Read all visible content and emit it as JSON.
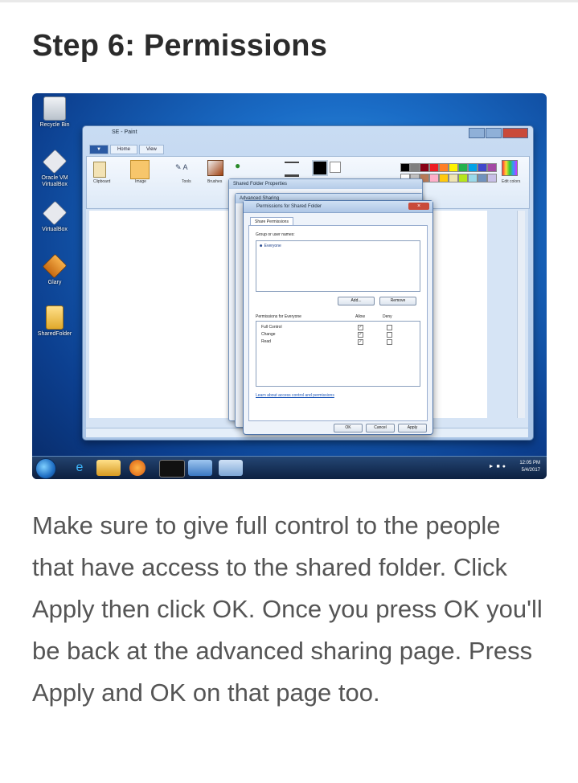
{
  "article": {
    "title": "Step 6: Permissions",
    "caption": "Make sure to give full control to the people that have access to the shared folder. Click Apply then click OK. Once you press OK you'll be back at the advanced sharing page. Press Apply and OK on that page too."
  },
  "screenshot": {
    "desktop_icons": [
      {
        "label": "Recycle Bin",
        "icon": "recycle-bin-icon",
        "color": "#d8dde3"
      },
      {
        "label": "Oracle VM VirtualBox",
        "icon": "virtualbox-icon",
        "color": "#e7e9ee"
      },
      {
        "label": "VirtualBox",
        "icon": "box-icon",
        "color": "#e7e9ee"
      },
      {
        "label": "Glary",
        "icon": "package-icon",
        "color": "#e58b25"
      },
      {
        "label": "SharedFolder",
        "icon": "folder-icon",
        "color": "#f2c94c"
      }
    ],
    "paint": {
      "title": "SE - Paint",
      "tabs": [
        "Home",
        "View"
      ],
      "file_tab": "",
      "groups": [
        "Clipboard",
        "Image",
        "Tools",
        "Brushes",
        "Shapes",
        "Size",
        "Color 1",
        "Color 2",
        "Edit colors"
      ],
      "swatch_colors": [
        "#000000",
        "#7f7f7f",
        "#880015",
        "#ed1c24",
        "#ff7f27",
        "#fff200",
        "#22b14c",
        "#00a2e8",
        "#3f48cc",
        "#a349a4",
        "#ffffff",
        "#c3c3c3",
        "#b97a57",
        "#ffaec9",
        "#ffc90e",
        "#efe4b0",
        "#b5e61d",
        "#99d9ea",
        "#7092be",
        "#c8bfe7"
      ]
    },
    "shared_folder_properties": {
      "title": "Shared Folder Properties"
    },
    "advanced_sharing": {
      "title": "Advanced Sharing"
    },
    "permissions_dialog": {
      "title": "Permissions for Shared Folder",
      "tab": "Share Permissions",
      "group_label": "Group or user names:",
      "users": [
        "Everyone"
      ],
      "add_button": "Add...",
      "remove_button": "Remove",
      "perm_header": "Permissions for Everyone",
      "allow_label": "Allow",
      "deny_label": "Deny",
      "permissions": [
        {
          "name": "Full Control",
          "allow": true,
          "deny": false
        },
        {
          "name": "Change",
          "allow": true,
          "deny": false
        },
        {
          "name": "Read",
          "allow": true,
          "deny": false
        }
      ],
      "help_link": "Learn about access control and permissions",
      "ok_button": "OK",
      "cancel_button": "Cancel",
      "apply_button": "Apply"
    },
    "taskbar": {
      "time": "12:05 PM",
      "date": "5/4/2017",
      "pinned": [
        "internet-explorer-icon",
        "explorer-icon",
        "media-player-icon",
        "cmd-icon",
        "virtualbox-icon",
        "paint-icon"
      ]
    }
  }
}
